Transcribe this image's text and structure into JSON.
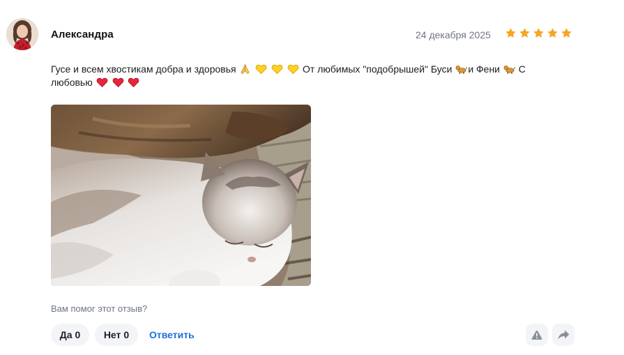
{
  "review": {
    "author": {
      "name": "Александра",
      "avatar": "avatar"
    },
    "date": "24 декабря 2025",
    "rating": {
      "value": 5,
      "max": 5,
      "color": "#f5a623"
    },
    "text": {
      "part1": "Гусе и всем хвостикам добра и здоровья",
      "part2": "От любимых \"подобрышей\" Буси",
      "part3": "и Фени",
      "part4": "С любовью"
    },
    "photo": {
      "icon": "review-photo"
    },
    "helpful": {
      "question": "Вам помог этот отзыв?",
      "yes_label": "Да",
      "yes_count": "0",
      "no_label": "Нет",
      "no_count": "0"
    },
    "reply_label": "Ответить",
    "actions": {
      "report_icon": "warning-icon",
      "share_icon": "share-icon"
    },
    "colors": {
      "accent": "#1a6fe0",
      "muted_text": "#6f7682",
      "button_bg": "#f3f4f7"
    }
  }
}
